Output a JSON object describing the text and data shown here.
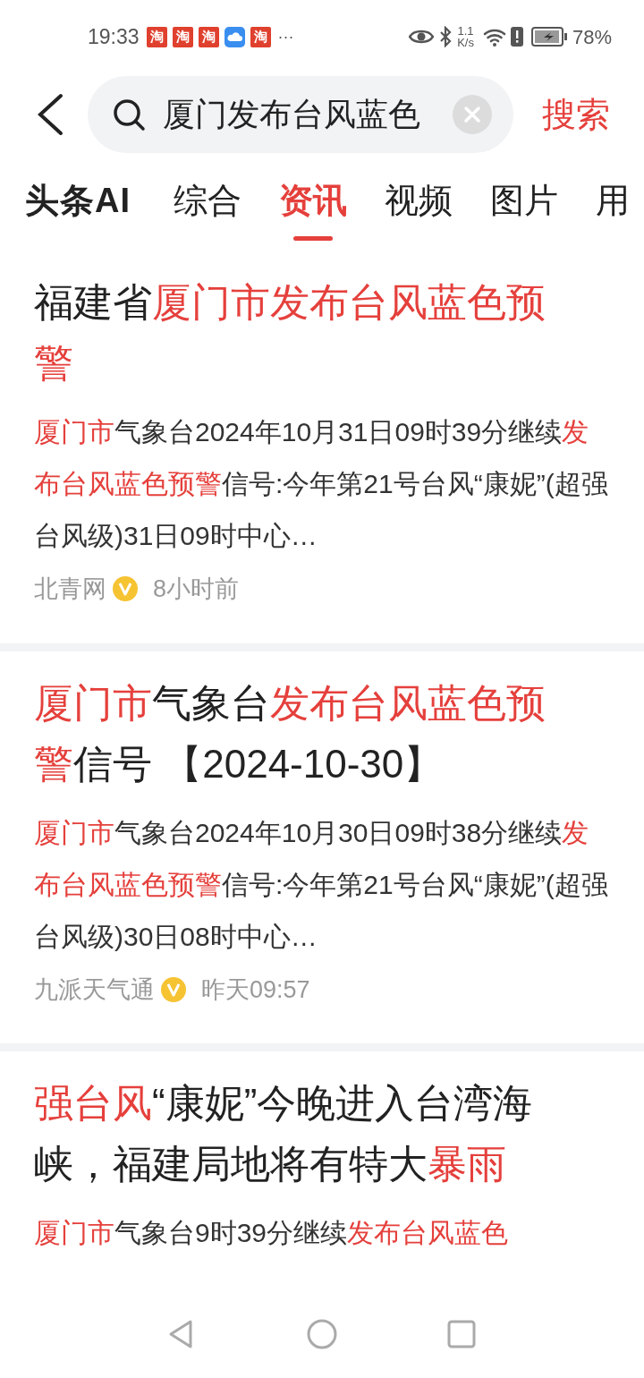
{
  "status_bar": {
    "time": "19:33",
    "notifications": [
      {
        "kind": "app",
        "glyph": "淘"
      },
      {
        "kind": "app",
        "glyph": "淘"
      },
      {
        "kind": "app",
        "glyph": "淘"
      },
      {
        "kind": "cloud"
      },
      {
        "kind": "app",
        "glyph": "淘"
      }
    ],
    "more": "···",
    "speed_value": "1.1",
    "speed_unit": "K/s",
    "battery": "78%"
  },
  "search": {
    "value": "厦门发布台风蓝色",
    "button": "搜索"
  },
  "tabs": [
    {
      "label": "头条AI",
      "kind": "brand",
      "selected": false
    },
    {
      "label": "综合",
      "kind": "tab",
      "selected": false
    },
    {
      "label": "资讯",
      "kind": "tab",
      "selected": true
    },
    {
      "label": "视频",
      "kind": "tab",
      "selected": false
    },
    {
      "label": "图片",
      "kind": "tab",
      "selected": false
    },
    {
      "label": "用",
      "kind": "tab",
      "selected": false
    }
  ],
  "articles": [
    {
      "title": [
        {
          "text": "福建省",
          "highlight": false
        },
        {
          "text": "厦门市发布台风蓝色预警",
          "highlight": true
        }
      ],
      "snippet": [
        {
          "text": "厦门市",
          "highlight": true
        },
        {
          "text": "气象台2024年10月31日09时39分继续",
          "highlight": false
        },
        {
          "text": "发布台风蓝色预警",
          "highlight": true
        },
        {
          "text": "信号:今年第21号台风“康妮”(超强台风级)31日09时中心…",
          "highlight": false
        }
      ],
      "source": "北青网",
      "verified": true,
      "time": "8小时前"
    },
    {
      "title": [
        {
          "text": "厦门市",
          "highlight": true
        },
        {
          "text": "气象台",
          "highlight": false
        },
        {
          "text": "发布台风蓝色预警",
          "highlight": true
        },
        {
          "text": "信号 【2024-10-30】",
          "highlight": false
        }
      ],
      "snippet": [
        {
          "text": "厦门市",
          "highlight": true
        },
        {
          "text": "气象台2024年10月30日09时38分继续",
          "highlight": false
        },
        {
          "text": "发布台风蓝色预警",
          "highlight": true
        },
        {
          "text": "信号:今年第21号台风“康妮”(超强台风级)30日08时中心…",
          "highlight": false
        }
      ],
      "source": "九派天气通",
      "verified": true,
      "time": "昨天09:57"
    },
    {
      "title": [
        {
          "text": "强台风",
          "highlight": true
        },
        {
          "text": "“康妮”今晚进入台湾海峡，福建局地将有特大",
          "highlight": false
        },
        {
          "text": "暴雨",
          "highlight": true
        }
      ],
      "snippet": [
        {
          "text": "厦门市",
          "highlight": true
        },
        {
          "text": "气象台9时39分继续",
          "highlight": false
        },
        {
          "text": "发布台风蓝色",
          "highlight": true
        }
      ]
    }
  ]
}
